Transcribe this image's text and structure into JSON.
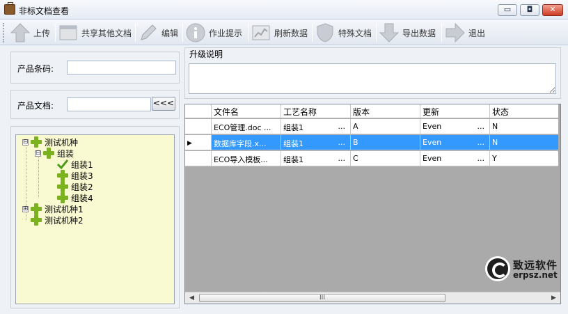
{
  "window": {
    "title": "非标文档查看",
    "minimize_glyph": "▭",
    "restore_glyph": "◘",
    "close_glyph": "✕"
  },
  "toolbar": {
    "items": [
      {
        "label": "上传",
        "icon": "up-arrow-icon"
      },
      {
        "label": "共享其他文档",
        "icon": "window-icon"
      },
      {
        "label": "编辑",
        "icon": "pencil-icon"
      },
      {
        "label": "作业提示",
        "icon": "info-icon"
      },
      {
        "label": "刷新数据",
        "icon": "chart-icon"
      },
      {
        "label": "特殊文档",
        "icon": "shield-icon"
      },
      {
        "label": "导出数据",
        "icon": "down-arrow-icon"
      },
      {
        "label": "退出",
        "icon": "right-arrow-icon"
      }
    ]
  },
  "form": {
    "barcode_label": "产品条码:",
    "barcode_value": "",
    "document_label": "产品文档:",
    "document_value": "",
    "browse_label": "<<<"
  },
  "tree": {
    "nodes": [
      {
        "label": "测试机种",
        "expander": "⊟"
      },
      {
        "label": "组装",
        "expander": "⊟"
      },
      {
        "label": "组装1"
      },
      {
        "label": "组装3"
      },
      {
        "label": "组装2"
      },
      {
        "label": "组装4"
      },
      {
        "label": "测试机种1",
        "expander": "⊞"
      },
      {
        "label": "测试机种2"
      }
    ]
  },
  "upgrade": {
    "title": "升级说明",
    "text": ""
  },
  "grid": {
    "columns": [
      "文件名",
      "工艺名称",
      "版本",
      "更新",
      "状态"
    ],
    "ellipsis": "...",
    "rows": [
      {
        "filename": "ECO管理.doc ...",
        "process": "组装1",
        "version": "A",
        "updated": "Even",
        "status": "N",
        "selected": false
      },
      {
        "filename": "数据库字段.x...",
        "process": "组装1",
        "version": "B",
        "updated": "Even",
        "status": "N",
        "selected": true
      },
      {
        "filename": "ECO导入模板...",
        "process": "组装1",
        "version": "C",
        "updated": "Even",
        "status": "Y",
        "selected": false
      }
    ],
    "row_indicator": "▶",
    "scroll_left": "◀",
    "scroll_right": "▶",
    "scroll_thumb_grip": "III"
  },
  "watermark": {
    "name": "致远软件",
    "url": "erpsz.net"
  }
}
